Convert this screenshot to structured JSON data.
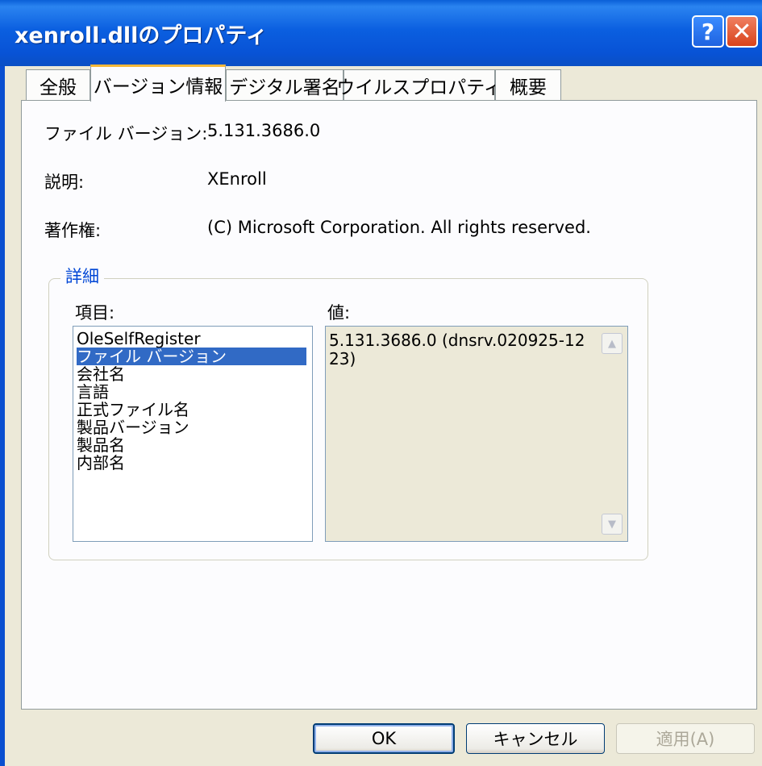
{
  "window": {
    "title": "xenroll.dllのプロパティ"
  },
  "titlebar_buttons": {
    "help": "?",
    "close": "✕"
  },
  "tabs": [
    "全般",
    "バージョン情報",
    "デジタル署名",
    "ウイルスプロパティ",
    "概要"
  ],
  "active_tab": "バージョン情報",
  "version_info": {
    "file_version_label": "ファイル バージョン:",
    "file_version_value": "5.131.3686.0",
    "description_label": "説明:",
    "description_value": "XEnroll",
    "copyright_label": "著作権:",
    "copyright_value": "(C) Microsoft Corporation. All rights reserved."
  },
  "details": {
    "group_title": "詳細",
    "items_label": "項目:",
    "value_label": "値:",
    "items": [
      "OleSelfRegister",
      "ファイル バージョン",
      "会社名",
      "言語",
      "正式ファイル名",
      "製品バージョン",
      "製品名",
      "内部名"
    ],
    "selected_item": "ファイル バージョン",
    "value_text": "5.131.3686.0 (dnsrv.020925-1223)"
  },
  "buttons": {
    "ok": "OK",
    "cancel": "キャンセル",
    "apply": "適用(A)"
  },
  "colors": {
    "titlebar": "#0b5fe0",
    "selection": "#316ac5",
    "group_title": "#0046d5",
    "active_tab_accent": "#f7b839",
    "window_bg": "#ece9d8"
  }
}
